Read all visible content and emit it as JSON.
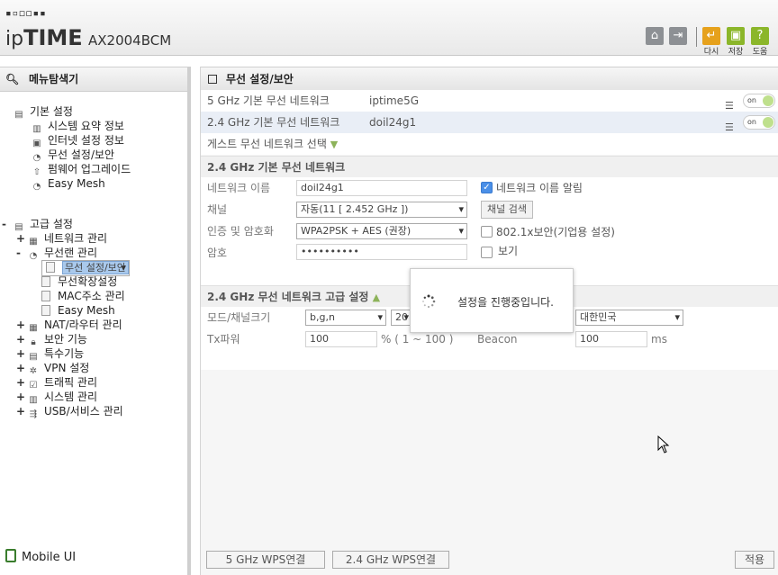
{
  "header": {
    "logo_dots": "▪▫◻◻▪▪",
    "brand_pre": "ip",
    "brand_bold": "TIME",
    "model": "AX2004BCM",
    "buttons": {
      "home_icon": "home-icon",
      "logout_icon": "logout-icon",
      "restart_label": "다시",
      "save_label": "저장",
      "help_label": "도움"
    }
  },
  "sidebar": {
    "title": "메뉴탐색기",
    "basic": {
      "label": "기본 설정",
      "items": [
        "시스템 요약 정보",
        "인터넷 설정 정보",
        "무선 설정/보안",
        "펌웨어 업그레이드",
        "Easy Mesh"
      ]
    },
    "advanced": {
      "label": "고급 설정",
      "network": "네트워크 관리",
      "wireless": "무선랜 관리",
      "wireless_items": [
        "무선 설정/보안",
        "무선확장설정",
        "MAC주소 관리",
        "Easy Mesh"
      ],
      "others": [
        "NAT/라우터 관리",
        "보안 기능",
        "특수기능",
        "VPN 설정",
        "트래픽 관리",
        "시스템 관리",
        "USB/서비스 관리"
      ]
    },
    "mobile_ui": "Mobile UI"
  },
  "main": {
    "title": "무선 설정/보안",
    "rows": [
      {
        "key": "5 GHz 기본 무선 네트워크",
        "value": "iptime5G",
        "toggle": "on"
      },
      {
        "key": "2.4 GHz 기본 무선 네트워크",
        "value": "doil24g1",
        "toggle": "on"
      }
    ],
    "guest_label": "게스트 무선 네트워크 선택",
    "basic_section": "2.4 GHz 기본 무선 네트워크",
    "form": {
      "network_name_label": "네트워크 이름",
      "network_name_value": "doil24g1",
      "broadcast_label": "네트워크 이름 알림",
      "channel_label": "채널",
      "channel_value": "자동(11 [ 2.452 GHz ])",
      "channel_search": "채널 검색",
      "auth_label": "인증 및 암호화",
      "auth_value": "WPA2PSK + AES (권장)",
      "dot1x_label": "802.1x보안(기업용 설정)",
      "password_label": "암호",
      "password_value": "••••••••••",
      "show_label": "보기"
    },
    "advanced_section": "2.4 GHz 무선 네트워크 고급 설정",
    "adv": {
      "mode_label": "모드/채널크기",
      "mode_value": "b,g,n",
      "width_value": "20",
      "country_value": "대한민국",
      "tx_label": "Tx파워",
      "tx_value": "100",
      "tx_unit": "% ( 1 ~ 100 )",
      "beacon_label": "Beacon",
      "beacon_value": "100",
      "beacon_unit": "ms"
    },
    "modal_message": "설정을 진행중입니다.",
    "footer": {
      "wps5": "5 GHz WPS연결",
      "wps24": "2.4 GHz WPS연결",
      "apply": "적용"
    }
  }
}
